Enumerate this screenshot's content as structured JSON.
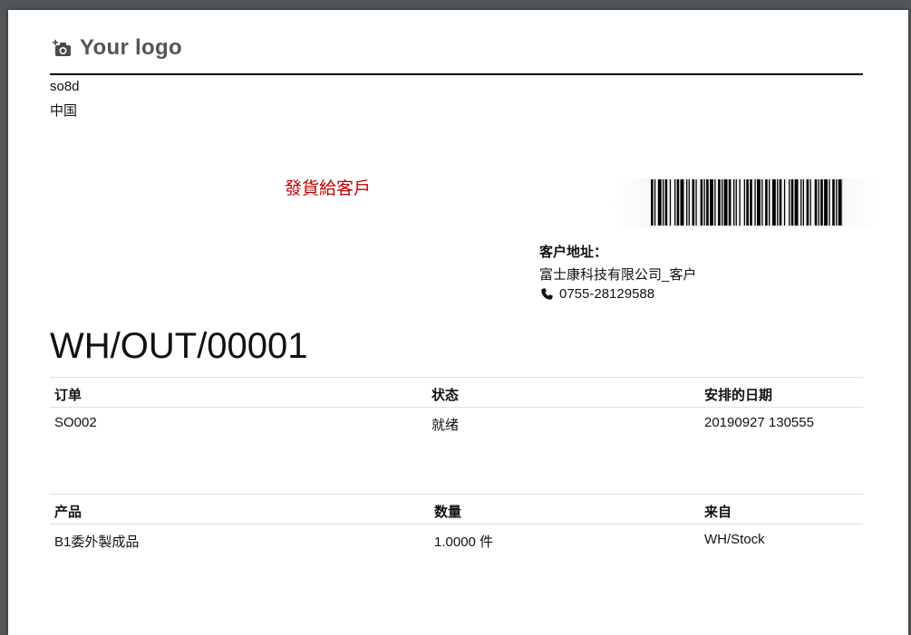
{
  "logo": {
    "text": "Your logo",
    "icon": "camera-icon"
  },
  "company": {
    "name": "so8d",
    "country": "中国"
  },
  "document_heading": "發貨給客戶",
  "customer": {
    "label": "客户地址：",
    "name": "富士康科技有限公司_客户",
    "phone": "0755-28129588",
    "phone_icon": "phone-icon"
  },
  "title": "WH/OUT/00001",
  "info_table": {
    "headers": [
      "订单",
      "状态",
      "安排的日期"
    ],
    "row": [
      "SO002",
      "就绪",
      "20190927 130555"
    ]
  },
  "lines_table": {
    "headers": [
      "产品",
      "数量",
      "来自"
    ],
    "row": [
      "B1委外製成品",
      "1.0000 件",
      "WH/Stock"
    ]
  },
  "colors": {
    "heading_red": "#c00000",
    "frame": "#525659"
  }
}
